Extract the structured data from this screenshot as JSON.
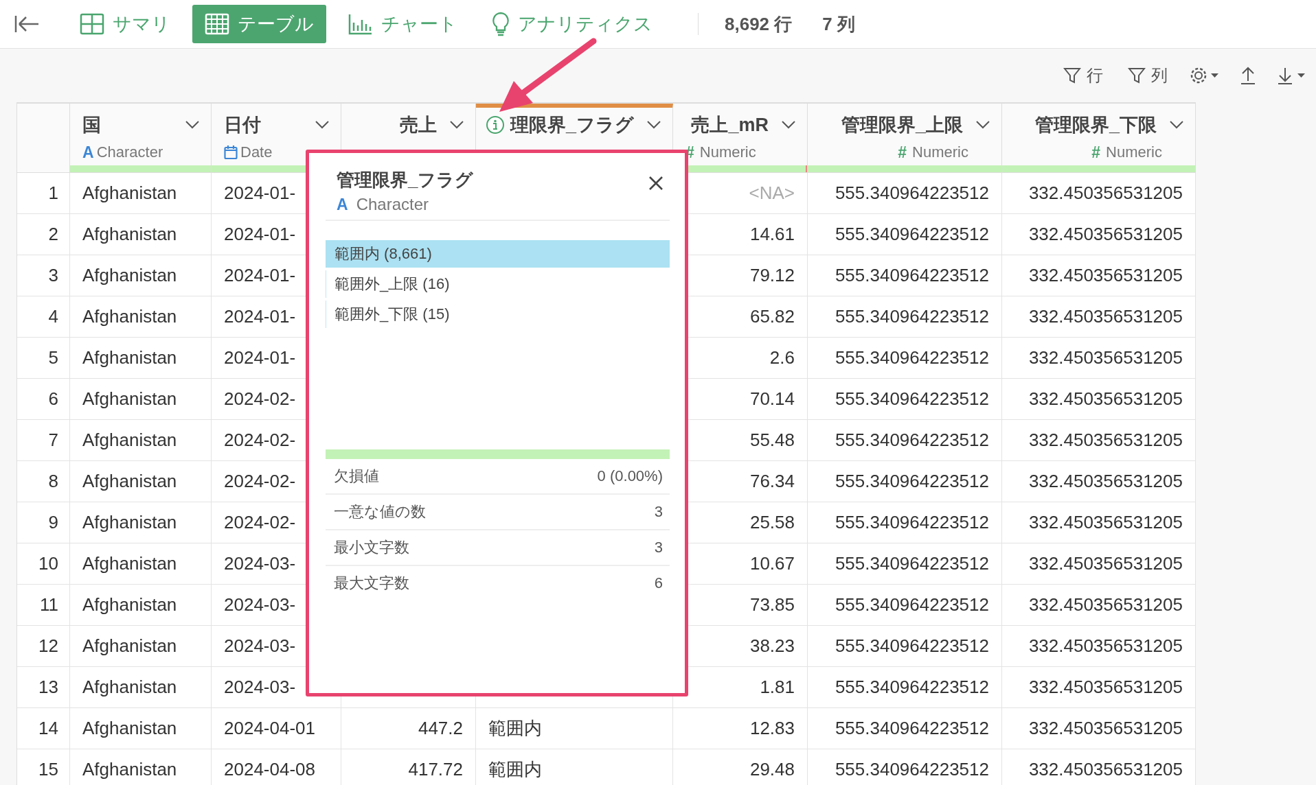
{
  "nav": {
    "tabs": [
      {
        "label": "サマリ",
        "selected": false
      },
      {
        "label": "テーブル",
        "selected": true
      },
      {
        "label": "チャート",
        "selected": false
      },
      {
        "label": "アナリティクス",
        "selected": false
      }
    ],
    "row_count": "8,692 行",
    "col_count": "7 列"
  },
  "toolbar": {
    "row_filter": "行",
    "col_filter": "列"
  },
  "table": {
    "columns": [
      {
        "name": "国",
        "type": "Character",
        "kind": "character",
        "type_glyph": "A",
        "level": 1,
        "selected": false,
        "info": false
      },
      {
        "name": "日付",
        "type": "Date",
        "kind": "date",
        "level": 1,
        "selected": false,
        "info": false
      },
      {
        "name": "売上",
        "kind": "numeric",
        "selected": false,
        "info": false
      },
      {
        "name": "理限界_フラグ",
        "kind": "character",
        "selected": true,
        "info": true
      },
      {
        "name": "売上_mR",
        "type": "Numeric",
        "kind": "numeric",
        "type_glyph": "#",
        "level": 0.99,
        "selected": false,
        "info": false
      },
      {
        "name": "管理限界_上限",
        "type": "Numeric",
        "kind": "numeric",
        "type_glyph": "#",
        "level": 1,
        "selected": false,
        "info": false
      },
      {
        "name": "管理限界_下限",
        "type": "Numeric",
        "kind": "numeric",
        "type_glyph": "#",
        "level": 1,
        "selected": false,
        "info": false
      }
    ],
    "rows": [
      {
        "index": "1",
        "cells": [
          "Afghanistan",
          "2024-01-",
          null,
          null,
          "<NA>",
          "555.340964223512",
          "332.450356531205"
        ],
        "missing": true
      },
      {
        "index": "2",
        "cells": [
          "Afghanistan",
          "2024-01-",
          null,
          null,
          "14.61",
          "555.340964223512",
          "332.450356531205"
        ],
        "missing": false
      },
      {
        "index": "3",
        "cells": [
          "Afghanistan",
          "2024-01-",
          null,
          null,
          "79.12",
          "555.340964223512",
          "332.450356531205"
        ],
        "missing": false
      },
      {
        "index": "4",
        "cells": [
          "Afghanistan",
          "2024-01-",
          null,
          null,
          "65.82",
          "555.340964223512",
          "332.450356531205"
        ],
        "missing": false
      },
      {
        "index": "5",
        "cells": [
          "Afghanistan",
          "2024-01-",
          null,
          null,
          "2.6",
          "555.340964223512",
          "332.450356531205"
        ],
        "missing": false
      },
      {
        "index": "6",
        "cells": [
          "Afghanistan",
          "2024-02-",
          null,
          null,
          "70.14",
          "555.340964223512",
          "332.450356531205"
        ],
        "missing": false
      },
      {
        "index": "7",
        "cells": [
          "Afghanistan",
          "2024-02-",
          null,
          null,
          "55.48",
          "555.340964223512",
          "332.450356531205"
        ],
        "missing": false
      },
      {
        "index": "8",
        "cells": [
          "Afghanistan",
          "2024-02-",
          null,
          null,
          "76.34",
          "555.340964223512",
          "332.450356531205"
        ],
        "missing": false
      },
      {
        "index": "9",
        "cells": [
          "Afghanistan",
          "2024-02-",
          null,
          null,
          "25.58",
          "555.340964223512",
          "332.450356531205"
        ],
        "missing": false
      },
      {
        "index": "10",
        "cells": [
          "Afghanistan",
          "2024-03-",
          null,
          null,
          "10.67",
          "555.340964223512",
          "332.450356531205"
        ],
        "missing": false
      },
      {
        "index": "11",
        "cells": [
          "Afghanistan",
          "2024-03-",
          null,
          null,
          "73.85",
          "555.340964223512",
          "332.450356531205"
        ],
        "missing": false
      },
      {
        "index": "12",
        "cells": [
          "Afghanistan",
          "2024-03-",
          null,
          null,
          "38.23",
          "555.340964223512",
          "332.450356531205"
        ],
        "missing": false
      },
      {
        "index": "13",
        "cells": [
          "Afghanistan",
          "2024-03-",
          null,
          null,
          "1.81",
          "555.340964223512",
          "332.450356531205"
        ],
        "missing": false
      },
      {
        "index": "14",
        "cells": [
          "Afghanistan",
          "2024-04-01",
          "447.2",
          "範囲内",
          "12.83",
          "555.340964223512",
          "332.450356531205"
        ],
        "missing": false
      },
      {
        "index": "15",
        "cells": [
          "Afghanistan",
          "2024-04-08",
          "417.72",
          "範囲内",
          "29.48",
          "555.340964223512",
          "332.450356531205"
        ],
        "missing": false
      }
    ]
  },
  "popup": {
    "title": "管理限界_フラグ",
    "type_glyph": "A",
    "type": "Character",
    "values": [
      {
        "label": "範囲内 (8,661)",
        "selected": true
      },
      {
        "label": "範囲外_上限 (16)",
        "selected": false
      },
      {
        "label": "範囲外_下限 (15)",
        "selected": false
      }
    ],
    "level": 1,
    "stats": [
      {
        "label": "欠損値",
        "value": "0 (0.00%)"
      },
      {
        "label": "一意な値の数",
        "value": "3"
      },
      {
        "label": "最小文字数",
        "value": "3"
      },
      {
        "label": "最大文字数",
        "value": "6"
      }
    ]
  }
}
